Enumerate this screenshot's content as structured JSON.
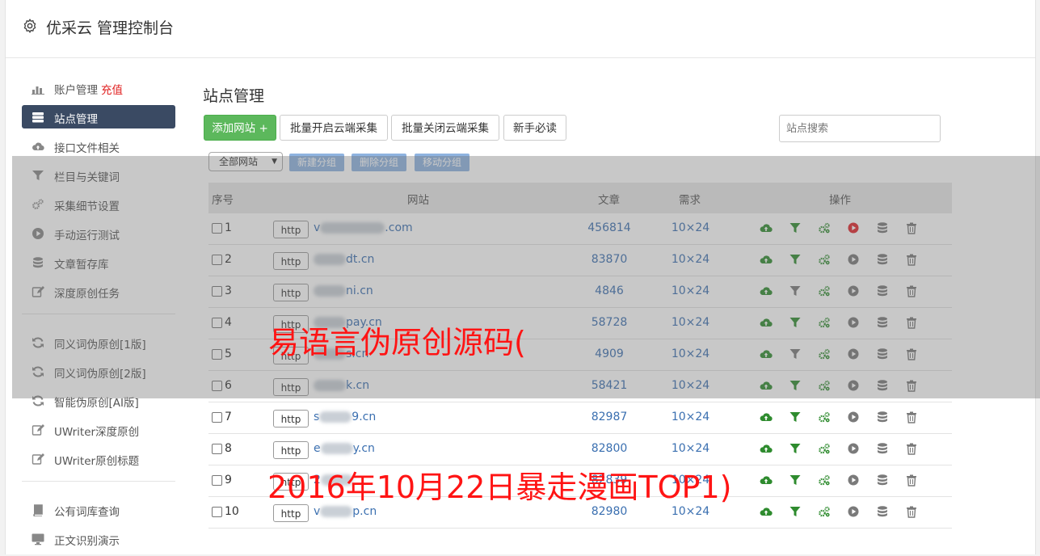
{
  "header": {
    "title": "优采云 管理控制台"
  },
  "sidebar": {
    "group1": [
      {
        "label": "账户管理",
        "extra": "充值",
        "icon": "bar-chart-icon",
        "active": false
      },
      {
        "label": "站点管理",
        "icon": "server-icon",
        "active": true
      },
      {
        "label": "接口文件相关",
        "icon": "cloud-upload-icon",
        "active": false
      },
      {
        "label": "栏目与关键词",
        "icon": "filter-icon",
        "active": false
      },
      {
        "label": "采集细节设置",
        "icon": "cogs-icon",
        "active": false
      },
      {
        "label": "手动运行测试",
        "icon": "play-icon",
        "active": false
      },
      {
        "label": "文章暂存库",
        "icon": "database-icon",
        "active": false
      },
      {
        "label": "深度原创任务",
        "icon": "edit-icon",
        "active": false
      }
    ],
    "group2": [
      {
        "label": "同义词伪原创[1版]",
        "icon": "refresh-icon"
      },
      {
        "label": "同义词伪原创[2版]",
        "icon": "refresh-icon"
      },
      {
        "label": "智能伪原创[AI版]",
        "icon": "refresh-icon"
      },
      {
        "label": "UWriter深度原创",
        "icon": "edit-icon"
      },
      {
        "label": "UWriter原创标题",
        "icon": "edit-icon"
      }
    ],
    "group3": [
      {
        "label": "公有词库查询",
        "icon": "book-icon"
      },
      {
        "label": "正文识别演示",
        "icon": "monitor-icon"
      }
    ]
  },
  "main": {
    "title": "站点管理",
    "toolbar": {
      "add_label": "添加网站 +",
      "batch_open": "批量开启云端采集",
      "batch_close": "批量关闭云端采集",
      "newbie": "新手必读",
      "search_placeholder": "站点搜索"
    },
    "group_select": "全部网站",
    "group_buttons": [
      "新建分组",
      "删除分组",
      "移动分组"
    ],
    "table": {
      "headers": [
        "序号",
        "网站",
        "文章",
        "需求",
        "操作"
      ],
      "rows": [
        {
          "no": "1",
          "proto": "http",
          "site_prefix": "v",
          "site_suffix": ".com",
          "articles": "456814",
          "need": "10×24",
          "filter_active": true,
          "play_active": true
        },
        {
          "no": "2",
          "proto": "http",
          "site_prefix": "",
          "site_suffix": "dt.cn",
          "articles": "83870",
          "need": "10×24",
          "filter_active": true,
          "play_active": false
        },
        {
          "no": "3",
          "proto": "http",
          "site_prefix": "",
          "site_suffix": "ni.cn",
          "articles": "4846",
          "need": "10×24",
          "filter_active": false,
          "play_active": false
        },
        {
          "no": "4",
          "proto": "http",
          "site_prefix": "",
          "site_suffix": "pay.cn",
          "articles": "58728",
          "need": "10×24",
          "filter_active": true,
          "play_active": false
        },
        {
          "no": "5",
          "proto": "http",
          "site_prefix": "",
          "site_suffix": "s.cn",
          "articles": "4909",
          "need": "10×24",
          "filter_active": false,
          "play_active": false
        },
        {
          "no": "6",
          "proto": "http",
          "site_prefix": "",
          "site_suffix": "k.cn",
          "articles": "58421",
          "need": "10×24",
          "filter_active": true,
          "play_active": false
        },
        {
          "no": "7",
          "proto": "http",
          "site_prefix": "s",
          "site_suffix": "9.cn",
          "articles": "82987",
          "need": "10×24",
          "filter_active": true,
          "play_active": false
        },
        {
          "no": "8",
          "proto": "http",
          "site_prefix": "e",
          "site_suffix": "y.cn",
          "articles": "82800",
          "need": "10×24",
          "filter_active": true,
          "play_active": false
        },
        {
          "no": "9",
          "proto": "http",
          "site_prefix": "2",
          "site_suffix": "",
          "articles": "82839",
          "need": "10×24",
          "filter_active": true,
          "play_active": false
        },
        {
          "no": "10",
          "proto": "http",
          "site_prefix": "v",
          "site_suffix": "p.cn",
          "articles": "82980",
          "need": "10×24",
          "filter_active": true,
          "play_active": false
        }
      ]
    }
  },
  "watermarks": [
    "易语言伪原创源码(",
    "2016年10月22日暴走漫画TOP1)"
  ],
  "colors": {
    "active_nav": "#3a4a63",
    "green_button": "#5cb85c",
    "link_blue": "#3a6fb0",
    "watermark_red": "#ff1414",
    "play_red": "#e0242b",
    "op_green": "#2e8b2e"
  }
}
